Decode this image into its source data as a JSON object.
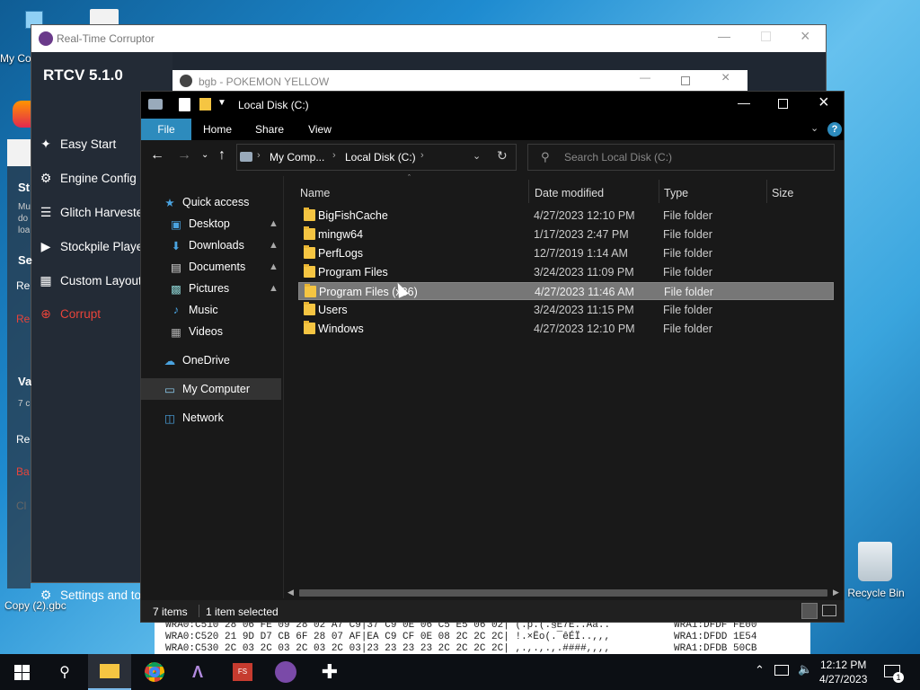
{
  "desktop": {
    "icons": [
      {
        "label": "My Co"
      },
      {
        "label": "Copy (2).gbc"
      },
      {
        "label": "Recycle Bin"
      }
    ]
  },
  "rtcv": {
    "window_title": "Real-Time Corruptor",
    "version": "RTCV 5.1.0",
    "nav": [
      {
        "label": "Easy Start",
        "icon": "wand-icon"
      },
      {
        "label": "Engine Config",
        "icon": "gear-icon"
      },
      {
        "label": "Glitch Harvester",
        "icon": "layers-icon"
      },
      {
        "label": "Stockpile Player",
        "icon": "play-icon"
      },
      {
        "label": "Custom Layout",
        "icon": "grid-icon"
      },
      {
        "label": "Corrupt",
        "icon": "crosshair-icon"
      }
    ],
    "settings_label": "Settings and too",
    "partial": {
      "st": "St",
      "mu": "Mu",
      "do": "do",
      "loa": "loa",
      "se": "Se",
      "re1": "Re",
      "re2": "Re",
      "va": "Va",
      "seven": "7 c",
      "re3": "Re",
      "ba": "Ba",
      "cl": "Cl"
    }
  },
  "bgb": {
    "window_title": "bgb - POKEMON YELLOW"
  },
  "hex": {
    "lines": [
      "WRA0:C510  28 06 FE 09 28 02 A7 C9|37 C9 0E 06 C5 E5 06 02| (.p.(.§É7É..Aå..",
      "WRA0:C520  21 9D D7 CB 6F 28 07 AF|EA C9 CF 0E 08 2C 2C 2C| !.×Ëo(.¯êÉÏ..,,,",
      "WRA0:C530  2C 03 2C 03 2C 03 2C 03|23 23 23 23 2C 2C 2C 2C| ,.,.,.,.####,,,,"
    ],
    "right": [
      "WRA1:DFDF FE00",
      "WRA1:DFDD 1E54",
      "WRA1:DFDB 50CB"
    ]
  },
  "explorer": {
    "title": "Local Disk (C:)",
    "tabs": [
      "File",
      "Home",
      "Share",
      "View"
    ],
    "breadcrumb": [
      "My Comp...",
      "Local Disk (C:)"
    ],
    "search_placeholder": "Search Local Disk (C:)",
    "nav": [
      {
        "label": "Quick access",
        "icon": "star-icon",
        "pinned": false
      },
      {
        "label": "Desktop",
        "icon": "desktop-icon",
        "pinned": true
      },
      {
        "label": "Downloads",
        "icon": "download-icon",
        "pinned": true
      },
      {
        "label": "Documents",
        "icon": "document-icon",
        "pinned": true
      },
      {
        "label": "Pictures",
        "icon": "picture-icon",
        "pinned": true
      },
      {
        "label": "Music",
        "icon": "music-icon",
        "pinned": false
      },
      {
        "label": "Videos",
        "icon": "video-icon",
        "pinned": false
      },
      {
        "label": "OneDrive",
        "icon": "cloud-icon",
        "pinned": false
      },
      {
        "label": "My Computer",
        "icon": "computer-icon",
        "pinned": false
      },
      {
        "label": "Network",
        "icon": "network-icon",
        "pinned": false
      }
    ],
    "columns": [
      "Name",
      "Date modified",
      "Type",
      "Size"
    ],
    "files": [
      {
        "name": "BigFishCache",
        "date": "4/27/2023 12:10 PM",
        "type": "File folder"
      },
      {
        "name": "mingw64",
        "date": "1/17/2023 2:47 PM",
        "type": "File folder"
      },
      {
        "name": "PerfLogs",
        "date": "12/7/2019 1:14 AM",
        "type": "File folder"
      },
      {
        "name": "Program Files",
        "date": "3/24/2023 11:09 PM",
        "type": "File folder"
      },
      {
        "name": "Program Files (x86)",
        "date": "4/27/2023 11:46 AM",
        "type": "File folder"
      },
      {
        "name": "Users",
        "date": "3/24/2023 11:15 PM",
        "type": "File folder"
      },
      {
        "name": "Windows",
        "date": "4/27/2023 12:10 PM",
        "type": "File folder"
      }
    ],
    "status_count": "7 items",
    "status_selected": "1 item selected"
  },
  "taskbar": {
    "time": "12:12 PM",
    "date": "4/27/2023",
    "notifications": "1"
  },
  "colors": {
    "accent": "#2d8bbd",
    "selected_row": "#777777",
    "corrupt_red": "#e8443a"
  }
}
